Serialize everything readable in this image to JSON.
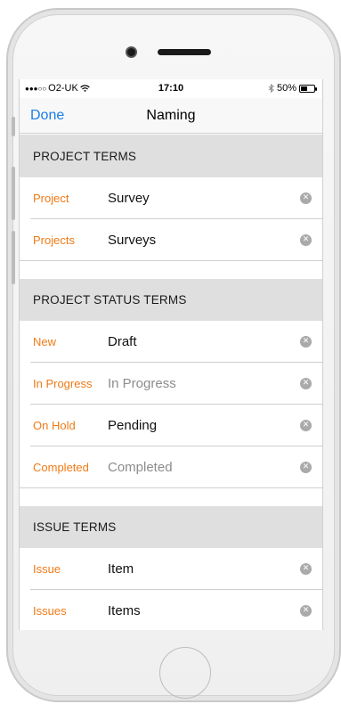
{
  "status_bar": {
    "signal_dots": "●●●○○",
    "carrier": "O2-UK",
    "wifi_icon": "wifi-icon",
    "time": "17:10",
    "bluetooth_icon": "bluetooth-icon",
    "battery_text": "50%",
    "battery_level": 0.5
  },
  "nav": {
    "done_label": "Done",
    "title": "Naming",
    "accent": "#1a7ee6"
  },
  "colors": {
    "label": "#f07a16",
    "section_bg": "#dfdfdf",
    "clear_icon": "#aaaaaa"
  },
  "sections": [
    {
      "header": "PROJECT TERMS",
      "rows": [
        {
          "label": "Project",
          "value": "Survey",
          "placeholder": ""
        },
        {
          "label": "Projects",
          "value": "Surveys",
          "placeholder": ""
        }
      ]
    },
    {
      "header": "PROJECT STATUS TERMS",
      "rows": [
        {
          "label": "New",
          "value": "Draft",
          "placeholder": ""
        },
        {
          "label": "In Progress",
          "value": "",
          "placeholder": "In Progress"
        },
        {
          "label": "On Hold",
          "value": "Pending",
          "placeholder": ""
        },
        {
          "label": "Completed",
          "value": "",
          "placeholder": "Completed"
        }
      ]
    },
    {
      "header": "ISSUE TERMS",
      "rows": [
        {
          "label": "Issue",
          "value": "Item",
          "placeholder": ""
        },
        {
          "label": "Issues",
          "value": "Items",
          "placeholder": ""
        }
      ]
    }
  ],
  "clear_icon_glyph": "✕"
}
